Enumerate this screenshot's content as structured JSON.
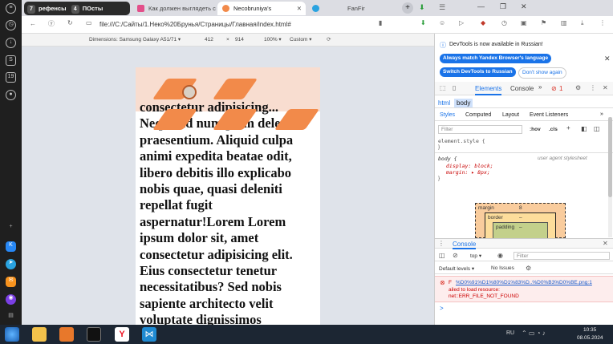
{
  "tabs": {
    "group_count": "7",
    "group_label": "рефенсы",
    "group2_count": "4",
    "group2_label": "ПОсты",
    "tab1": "Как должен выглядеть са",
    "tab_active": "Necobruniya's",
    "tab3": "FanFir"
  },
  "toolbar": {
    "url": "file:///C:/Сайты/1.Неко%20Брунья/Страницы/Главная/index.html#"
  },
  "device_toolbar": {
    "dimensions": "Dimensions: Samsung Galaxy A51/71 ▾",
    "width": "412",
    "x": "×",
    "height": "914",
    "zoom": "100% ▾",
    "throttle": "Custom ▾"
  },
  "page": {
    "text": "consectetur adipisicing... Neque ad numquam deleniti praesentium. Aliquid culpa animi expedita beatae odit, libero debitis illo explicabo nobis quae, quasi deleniti repellat fugit aspernatur!Lorem Lorem ipsum dolor sit, amet consectetur adipisicing elit. Eius consectetur tenetur necessitatibus? Sed nobis sapiente architecto velit voluptate dignissimos"
  },
  "devtools": {
    "notice": "DevTools is now available in Russian!",
    "btn_match": "Always match Yandex Browser's language",
    "btn_switch": "Switch DevTools to Russian",
    "btn_dont": "Don't show again",
    "tab_elements": "Elements",
    "tab_console": "Console",
    "error_count": "1",
    "crumb_html": "html",
    "crumb_body": "body",
    "styles_tabs": [
      "Styles",
      "Computed",
      "Layout",
      "Event Listeners"
    ],
    "filter_placeholder": "Filter",
    "hov": ":hov",
    "cls": ".cls",
    "rule1": "element.style {",
    "rule1_close": "}",
    "rule2_selector": "body {",
    "rule2_source": "user agent stylesheet",
    "rule2_prop1": "display: block;",
    "rule2_prop2": "margin: ▸ 8px;",
    "rule2_close": "}",
    "box_margin": "margin",
    "box_margin_val": "8",
    "box_border": "border",
    "box_border_val": "–",
    "box_padding": "padding",
    "box_padding_val": "–",
    "console_title": "Console",
    "context": "top ▾",
    "console_filter": "Filter",
    "levels": "Default levels ▾",
    "issues": "No Issues",
    "error_link": "%D0%91%D1%80%D1%83%D..%D0%B3%D0%BE.png:1",
    "error_prefix": "F",
    "error_line2": "ailed to load resource:",
    "error_line3": "net::ERR_FILE_NOT_FOUND",
    "prompt": ">"
  },
  "taskbar": {
    "lang": "RU",
    "time": "10:35",
    "date": "08.05.2024"
  }
}
